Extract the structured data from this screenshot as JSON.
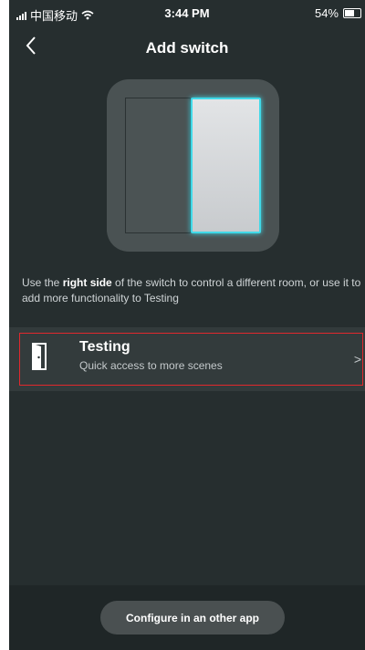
{
  "status_bar": {
    "carrier": "中国移动",
    "time": "3:44 PM",
    "battery_percent": "54%",
    "battery_level": 0.54,
    "icons": [
      "signal-icon",
      "wifi-icon",
      "battery-icon"
    ]
  },
  "nav": {
    "title": "Add switch",
    "back_icon": "chevron-left-icon"
  },
  "switch_illustration": {
    "highlighted_side": "right",
    "highlight_color": "#41d9e8"
  },
  "description": {
    "prefix": "Use the ",
    "bold": "right side",
    "suffix": " of the switch to control a different room, or use it to add more functionality to Testing"
  },
  "room_row": {
    "name": "Testing",
    "subtitle": "Quick access to more scenes",
    "icon": "door-icon",
    "chevron": ">"
  },
  "bottom": {
    "configure_label": "Configure in an other app"
  },
  "colors": {
    "background": "#262e2f",
    "row_background": "#333b3c",
    "highlight_border": "#e1282d",
    "accent": "#41d9e8"
  }
}
